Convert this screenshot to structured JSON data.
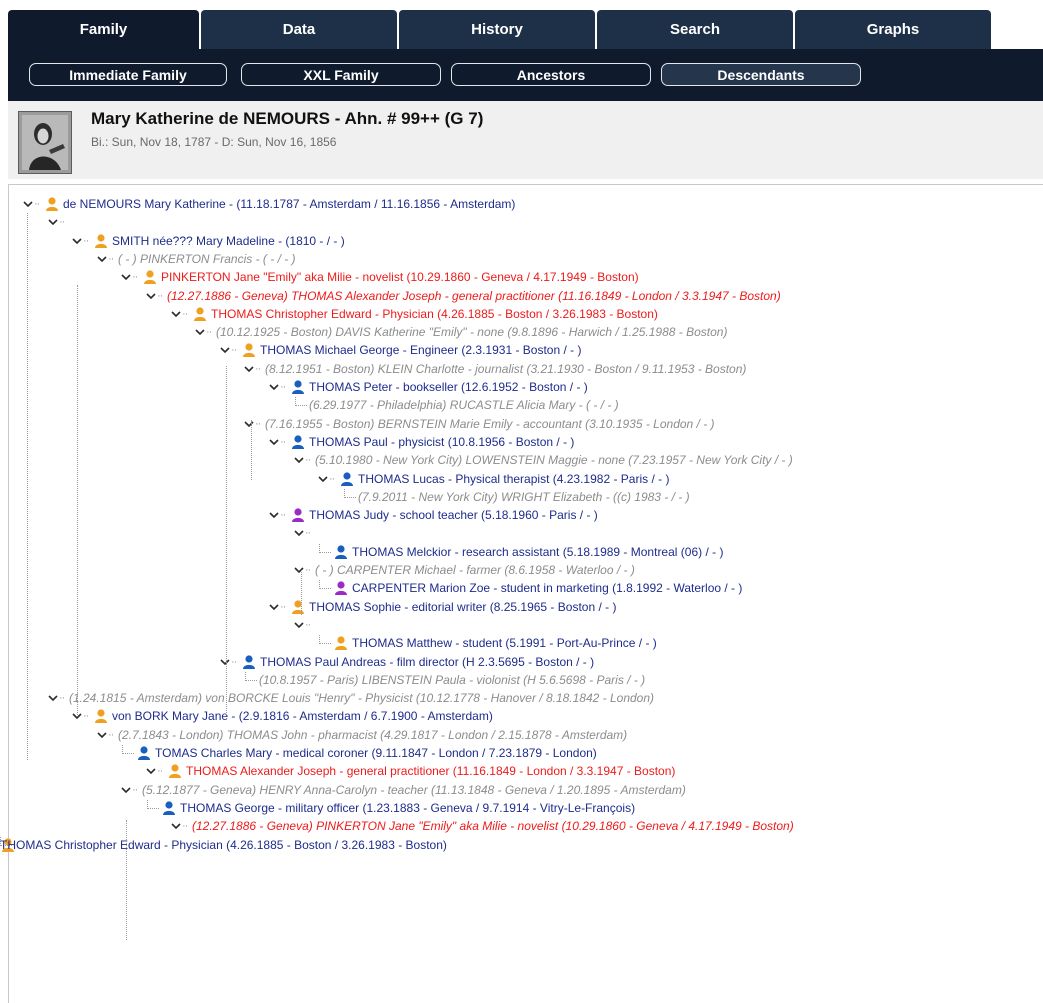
{
  "tabs": [
    {
      "label": "Family",
      "active": true
    },
    {
      "label": "Data",
      "active": false
    },
    {
      "label": "History",
      "active": false
    },
    {
      "label": "Search",
      "active": false
    },
    {
      "label": "Graphs",
      "active": false
    }
  ],
  "subtabs": [
    {
      "label": "Immediate Family",
      "active": false
    },
    {
      "label": "XXL Family",
      "active": false
    },
    {
      "label": "Ancestors",
      "active": false
    },
    {
      "label": "Descendants",
      "active": true
    }
  ],
  "person": {
    "name": "Mary Katherine de NEMOURS - Ahn. #  99++ (G 7)",
    "dates": "Bi.: Sun, Nov 18, 1787 - D: Sun, Nov 16, 1856"
  },
  "colors": {
    "tab": "#1e3048",
    "tab_active": "#0f1a2c",
    "person_blue": "#1e2c8c",
    "person_red": "#ee1b1b",
    "spouse_gray": "#8c8c8c",
    "female_icon": "#9a2bc8",
    "male_icon": "#1a5fc0",
    "unknown_icon": "#f0a020"
  },
  "tree": {
    "nodes": [
      {
        "id": "n1",
        "text": "de NEMOURS Mary Katherine -  (11.18.1787 - Amsterdam / 11.16.1856 - Amsterdam)",
        "style": "blue",
        "icon": "unknown-icon",
        "chevron": true
      },
      {
        "id": "n2",
        "text": "",
        "style": "blue",
        "icon": "",
        "chevron": true
      },
      {
        "id": "n3",
        "text": "SMITH née??? Mary Madeline -  (1810 -  / - )",
        "style": "blue",
        "icon": "unknown-icon",
        "chevron": true
      },
      {
        "id": "n4",
        "text": "( - ) PINKERTON Francis -  ( - / - )",
        "style": "gray",
        "icon": "",
        "chevron": true
      },
      {
        "id": "n5",
        "text": "PINKERTON Jane \"Emily\" aka Milie - novelist (10.29.1860 - Geneva / 4.17.1949 - Boston)",
        "style": "red",
        "icon": "unknown-icon",
        "chevron": true
      },
      {
        "id": "n6",
        "text": "(12.27.1886 - Geneva) THOMAS Alexander Joseph - general practitioner (11.16.1849 - London / 3.3.1947 - Boston)",
        "style": "redi",
        "icon": "",
        "chevron": true
      },
      {
        "id": "n7",
        "text": "THOMAS Christopher Edward - Physician (4.26.1885 - Boston / 3.26.1983 - Boston)",
        "style": "red",
        "icon": "unknown-icon",
        "chevron": true
      },
      {
        "id": "n8",
        "text": "(10.12.1925 - Boston) DAVIS Katherine \"Emily\" - none (9.8.1896 - Harwich / 1.25.1988 - Boston)",
        "style": "gray",
        "icon": "",
        "chevron": true
      },
      {
        "id": "n9",
        "text": "THOMAS Michael George - Engineer (2.3.1931 - Boston /  - )",
        "style": "blue",
        "icon": "unknown-icon",
        "chevron": true
      },
      {
        "id": "n10",
        "text": "(8.12.1951 - Boston) KLEIN Charlotte - journalist (3.21.1930 - Boston / 9.11.1953 - Boston)",
        "style": "gray",
        "icon": "",
        "chevron": true
      },
      {
        "id": "n11",
        "text": "THOMAS Peter - bookseller (12.6.1952 - Boston /  - )",
        "style": "blue",
        "icon": "male-icon",
        "chevron": true
      },
      {
        "id": "n12",
        "text": "(6.29.1977 - Philadelphia) RUCASTLE Alicia Mary -  ( - / - )",
        "style": "gray",
        "icon": "",
        "chevron": false
      },
      {
        "id": "n13",
        "text": "(7.16.1955 - Boston) BERNSTEIN Marie Emily - accountant (3.10.1935 - London /  - )",
        "style": "gray",
        "icon": "",
        "chevron": true
      },
      {
        "id": "n14",
        "text": "THOMAS Paul - physicist (10.8.1956 - Boston /  - )",
        "style": "blue",
        "icon": "male-icon",
        "chevron": true
      },
      {
        "id": "n15",
        "text": "(5.10.1980 - New York City) LOWENSTEIN Maggie - none (7.23.1957 - New York City /  - )",
        "style": "gray",
        "icon": "",
        "chevron": true
      },
      {
        "id": "n16",
        "text": "THOMAS Lucas - Physical therapist (4.23.1982 - Paris /  - )",
        "style": "blue",
        "icon": "male-icon",
        "chevron": true
      },
      {
        "id": "n17",
        "text": "(7.9.2011 - New York City) WRIGHT Elizabeth -  ((c) 1983 -  / - )",
        "style": "gray",
        "icon": "",
        "chevron": false
      },
      {
        "id": "n18",
        "text": "THOMAS Judy - school teacher (5.18.1960 - Paris /  - )",
        "style": "blue",
        "icon": "female-icon",
        "chevron": true
      },
      {
        "id": "n19",
        "text": "",
        "style": "blue",
        "icon": "",
        "chevron": true
      },
      {
        "id": "n20",
        "text": "THOMAS Melckior - research assistant (5.18.1989 - Montreal (06) /  - )",
        "style": "blue",
        "icon": "male-icon",
        "chevron": false
      },
      {
        "id": "n21",
        "text": "( - ) CARPENTER Michael - farmer (8.6.1958 - Waterloo /  - )",
        "style": "gray",
        "icon": "",
        "chevron": true
      },
      {
        "id": "n22",
        "text": "CARPENTER Marion Zoe - student in marketing (1.8.1992 - Waterloo /  - )",
        "style": "blue",
        "icon": "female-icon",
        "chevron": false
      },
      {
        "id": "n23",
        "text": "THOMAS Sophie - editorial writer (8.25.1965 - Boston /  - )",
        "style": "blue",
        "icon": "unknown-icon",
        "chevron": true
      },
      {
        "id": "n24",
        "text": "",
        "style": "blue",
        "icon": "",
        "chevron": true
      },
      {
        "id": "n25",
        "text": "THOMAS Matthew - student (5.1991 - Port-Au-Prince /  - )",
        "style": "blue",
        "icon": "unknown-icon",
        "chevron": false
      },
      {
        "id": "n26",
        "text": "THOMAS Paul Andreas - film director (H 2.3.5695 - Boston /  - )",
        "style": "blue",
        "icon": "male-icon",
        "chevron": true
      },
      {
        "id": "n27",
        "text": "(10.8.1957 - Paris) LIBENSTEIN Paula - violonist (H 5.6.5698 - Paris /  - )",
        "style": "gray",
        "icon": "",
        "chevron": false
      },
      {
        "id": "n28",
        "text": "(1.24.1815 - Amsterdam) von BORCKE Louis \"Henry\" - Physicist (10.12.1778 - Hanover / 8.18.1842 - London)",
        "style": "gray",
        "icon": "",
        "chevron": true
      },
      {
        "id": "n29",
        "text": "von BORK Mary Jane -  (2.9.1816 - Amsterdam / 6.7.1900 - Amsterdam)",
        "style": "blue",
        "icon": "unknown-icon",
        "chevron": true
      },
      {
        "id": "n30",
        "text": "(2.7.1843 - London) THOMAS John - pharmacist (4.29.1817 - London / 2.15.1878 - Amsterdam)",
        "style": "gray",
        "icon": "",
        "chevron": true
      },
      {
        "id": "n31",
        "text": "TOMAS Charles Mary - medical coroner (9.11.1847 - London / 7.23.1879 - London)",
        "style": "blue",
        "icon": "male-icon",
        "chevron": false
      },
      {
        "id": "n32",
        "text": "THOMAS Alexander Joseph - general practitioner (11.16.1849 - London / 3.3.1947 - Boston)",
        "style": "red",
        "icon": "unknown-icon",
        "chevron": true
      },
      {
        "id": "n33",
        "text": "(5.12.1877 - Geneva) HENRY Anna-Carolyn - teacher (11.13.1848 - Geneva / 1.20.1895 - Amsterdam)",
        "style": "gray",
        "icon": "",
        "chevron": true
      },
      {
        "id": "n34",
        "text": "THOMAS George - military officer (1.23.1883 - Geneva / 9.7.1914 - Vitry-Le-François)",
        "style": "blue",
        "icon": "male-icon",
        "chevron": false
      },
      {
        "id": "n35",
        "text": "(12.27.1886 - Geneva) PINKERTON Jane \"Emily\" aka Milie - novelist (10.29.1860 - Geneva / 4.17.1949 - Boston)",
        "style": "redi",
        "icon": "",
        "chevron": true
      },
      {
        "id": "n36",
        "text": "THOMAS Christopher Edward - Physician (4.26.1885 - Boston / 3.26.1983 - Boston)",
        "style": "blue",
        "icon": "unknown-icon",
        "chevron": false
      }
    ]
  }
}
